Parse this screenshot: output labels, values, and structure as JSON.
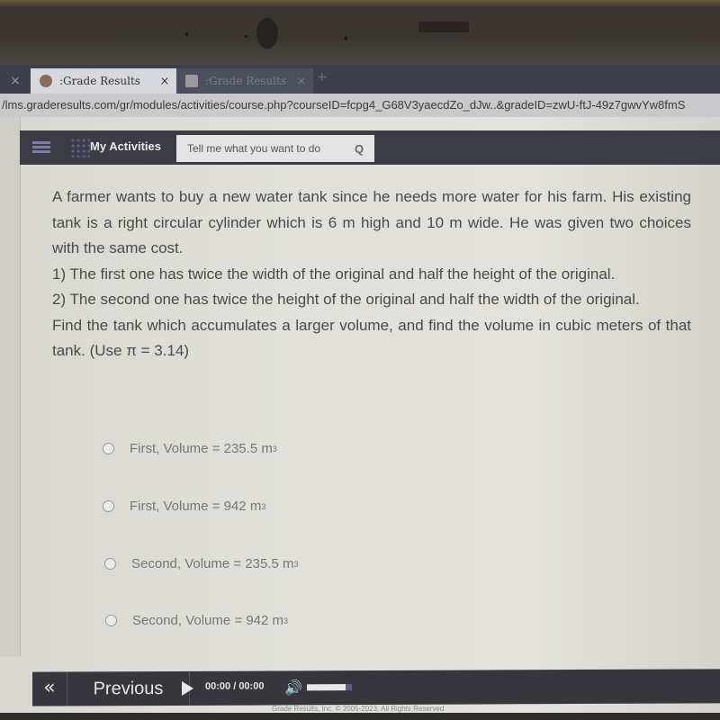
{
  "browser": {
    "tabs": [
      {
        "label": ":Grade Results",
        "active": true,
        "close": "×"
      },
      {
        "label": ":Grade Results",
        "active": false,
        "close": "×"
      }
    ],
    "stub_close": "×",
    "new_tab": "+",
    "url": "/lms.graderesults.com/gr/modules/activities/course.php?courseID=fcpg4_G68V3yaecdZo_dJw..&gradeID=zwU-ftJ-49z7gwvYw8fmS"
  },
  "navbar": {
    "menu_icon": "hamburger-icon",
    "activities_label": "My Activities",
    "search_placeholder": "Tell me what you want to do",
    "search_icon": "Q"
  },
  "question": {
    "paragraphs": [
      "A farmer wants to buy a new water tank since he needs more water for his farm. His existing tank is a right circular cylinder which is 6 m high and 10 m wide. He was given two choices with the same cost.",
      "1) The first one has twice the width of the original and half the height of the original.",
      "2) The second one has twice the height of the original and half the width of the original.",
      "Find the tank which accumulates a larger volume, and find the volume in cubic meters of that tank. (Use π = 3.14)"
    ]
  },
  "options": [
    {
      "label": "First, Volume = 235.5 m",
      "sup": "3",
      "selected": false
    },
    {
      "label": "First, Volume = 942 m",
      "sup": "3",
      "selected": false
    },
    {
      "label": "Second, Volume = 235.5 m",
      "sup": "3",
      "selected": false
    },
    {
      "label": "Second, Volume = 942 m",
      "sup": "3",
      "selected": false
    }
  ],
  "footer": {
    "prev_arrows": "«",
    "previous_label": "Previous",
    "time_current": "00:00",
    "time_separator": " / ",
    "time_total": "00:00",
    "volume_level": 0.85,
    "copyright": "Grade Results, Inc. © 2005-2023. All Rights Reserved"
  }
}
